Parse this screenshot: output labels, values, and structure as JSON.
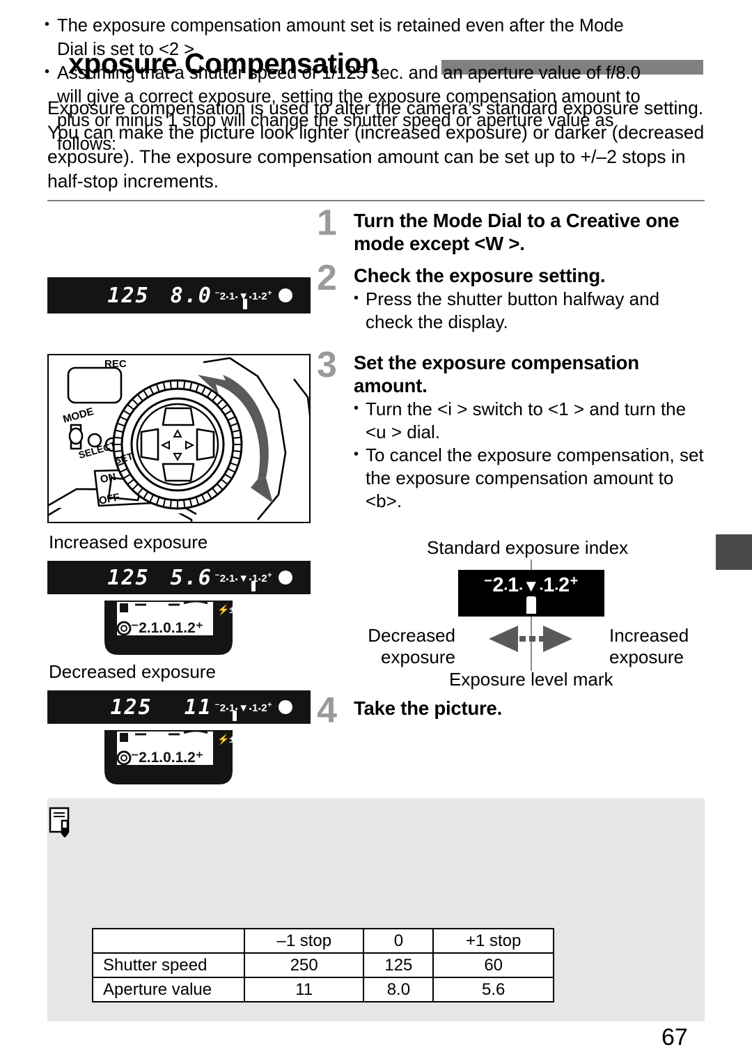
{
  "page": {
    "title": "xposure Compensation",
    "number": "67"
  },
  "intro": "Exposure compensation is used to alter the camera’s standard exposure setting. You can make the picture look lighter (increased exposure) or darker (decreased exposure). The exposure compensation amount can be set up to +/–2 stops in half-stop increments.",
  "steps": [
    {
      "num": "1",
      "heading": "Turn the Mode Dial to a Creative one mode except <W >.",
      "bullets": []
    },
    {
      "num": "2",
      "heading": "Check the exposure setting.",
      "bullets": [
        "Press the shutter button halfway and check the display."
      ]
    },
    {
      "num": "3",
      "heading": "Set the exposure compensation amount.",
      "bullets": [
        "Turn the <i    > switch to <1    > and turn the <u   > dial.",
        "To cancel the exposure compensation, set the exposure compensation amount to <b>."
      ]
    },
    {
      "num": "4",
      "heading": "Take the picture.",
      "bullets": []
    }
  ],
  "viewfinders": {
    "standard": {
      "shutter": "125",
      "aperture": "8.0",
      "scale_minus": "–2",
      "scale": "2 1     1 2",
      "scale_left": "2",
      "scale_1l": "1",
      "scale_1r": "1",
      "scale_right": "2",
      "mark_position": "center"
    },
    "increased": {
      "label": "Increased exposure",
      "shutter": "125",
      "aperture": "5.6",
      "mark_position": "plus-one"
    },
    "decreased": {
      "label": "Decreased exposure",
      "shutter": "125",
      "aperture": "11",
      "mark_position": "minus-one"
    },
    "lcd_scale": "–2.1.0.1.2+"
  },
  "exposure_diagram": {
    "top_label": "Standard exposure index",
    "bottom_label": "Exposure level mark",
    "left_label_line1": "Decreased",
    "left_label_line2": "exposure",
    "right_label_line1": "Increased",
    "right_label_line2": "exposure",
    "scale_minus": "–",
    "scale_text": "2 . 1 .    . 1 . 2",
    "scale_plus": "+"
  },
  "notes": {
    "items": [
      "The exposure compensation amount set is retained even after the Mode Dial is set to <2    >.",
      "Assuming that a shutter speed of 1/125 sec. and an aperture value of f/8.0 will give a correct exposure, setting the exposure compensation amount to plus or minus 1 stop will change the shutter speed or aperture value as follows:"
    ]
  },
  "table": {
    "columns": [
      "",
      "–1 stop",
      "0",
      "+1 stop"
    ],
    "rows": [
      {
        "label": "Shutter speed",
        "values": [
          "250",
          "125",
          "60"
        ]
      },
      {
        "label": "Aperture value",
        "values": [
          "11",
          "8.0",
          "5.6"
        ]
      }
    ]
  },
  "camera_illustration": {
    "labels": [
      "REC",
      "MODE",
      "SELECT",
      "SET",
      "ON",
      "OFF"
    ]
  },
  "colors": {
    "title_bar": "#808080",
    "step_number": "#9a9a9a",
    "note_background": "#e6e6e6",
    "lcd_background": "#141414",
    "side_tab": "#4a4a4a"
  }
}
